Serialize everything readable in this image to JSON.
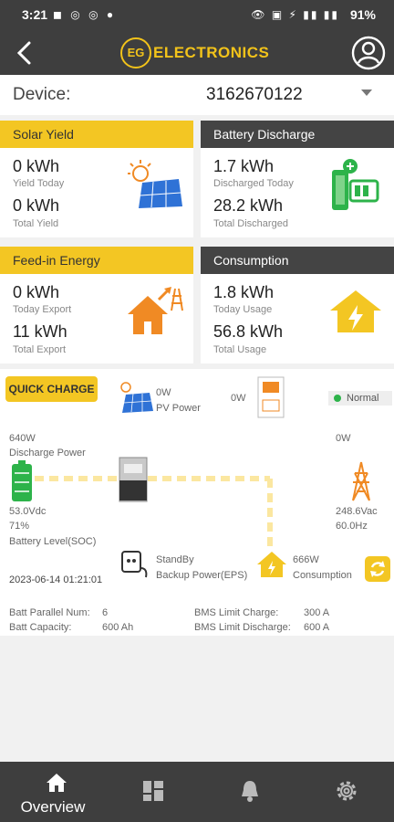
{
  "status_bar": {
    "time": "3:21",
    "battery": "91%"
  },
  "header": {
    "logo_mark": "EG",
    "logo_text": "ELECTRONICS"
  },
  "device": {
    "label": "Device:",
    "value": "3162670122"
  },
  "cards": {
    "solar_yield": {
      "title": "Solar Yield",
      "value1": "0 kWh",
      "label1": "Yield Today",
      "value2": "0 kWh",
      "label2": "Total Yield"
    },
    "battery_discharge": {
      "title": "Battery Discharge",
      "value1": "1.7 kWh",
      "label1": "Discharged Today",
      "value2": "28.2 kWh",
      "label2": "Total Discharged"
    },
    "feed_in": {
      "title": "Feed-in Energy",
      "value1": "0 kWh",
      "label1": "Today Export",
      "value2": "11 kWh",
      "label2": "Total Export"
    },
    "consumption": {
      "title": "Consumption",
      "value1": "1.8 kWh",
      "label1": "Today Usage",
      "value2": "56.8 kWh",
      "label2": "Total Usage"
    }
  },
  "flow": {
    "quick_charge": "QUICK CHARGE",
    "pv_value": "0W",
    "pv_label": "PV Power",
    "gen_value": "0W",
    "status": "Normal",
    "discharge_value": "640W",
    "discharge_label": "Discharge Power",
    "grid_value": "0W",
    "battery_voltage": "53.0Vdc",
    "battery_soc": "71%",
    "battery_label": "Battery Level(SOC)",
    "grid_voltage": "248.6Vac",
    "grid_freq": "60.0Hz",
    "eps_status": "StandBy",
    "eps_label": "Backup Power(EPS)",
    "consumption_value": "666W",
    "consumption_label": "Consumption",
    "timestamp": "2023-06-14 01:21:01",
    "batt_parallel_label": "Batt Parallel Num:",
    "batt_parallel_value": "6",
    "batt_capacity_label": "Batt Capacity:",
    "batt_capacity_value": "600 Ah",
    "bms_charge_label": "BMS Limit Charge:",
    "bms_charge_value": "300 A",
    "bms_discharge_label": "BMS Limit Discharge:",
    "bms_discharge_value": "600 A"
  },
  "nav": {
    "overview": "Overview"
  },
  "colors": {
    "accent": "#f3c623",
    "dark": "#3e3e3e",
    "green": "#2db34a",
    "orange": "#f08a24"
  }
}
